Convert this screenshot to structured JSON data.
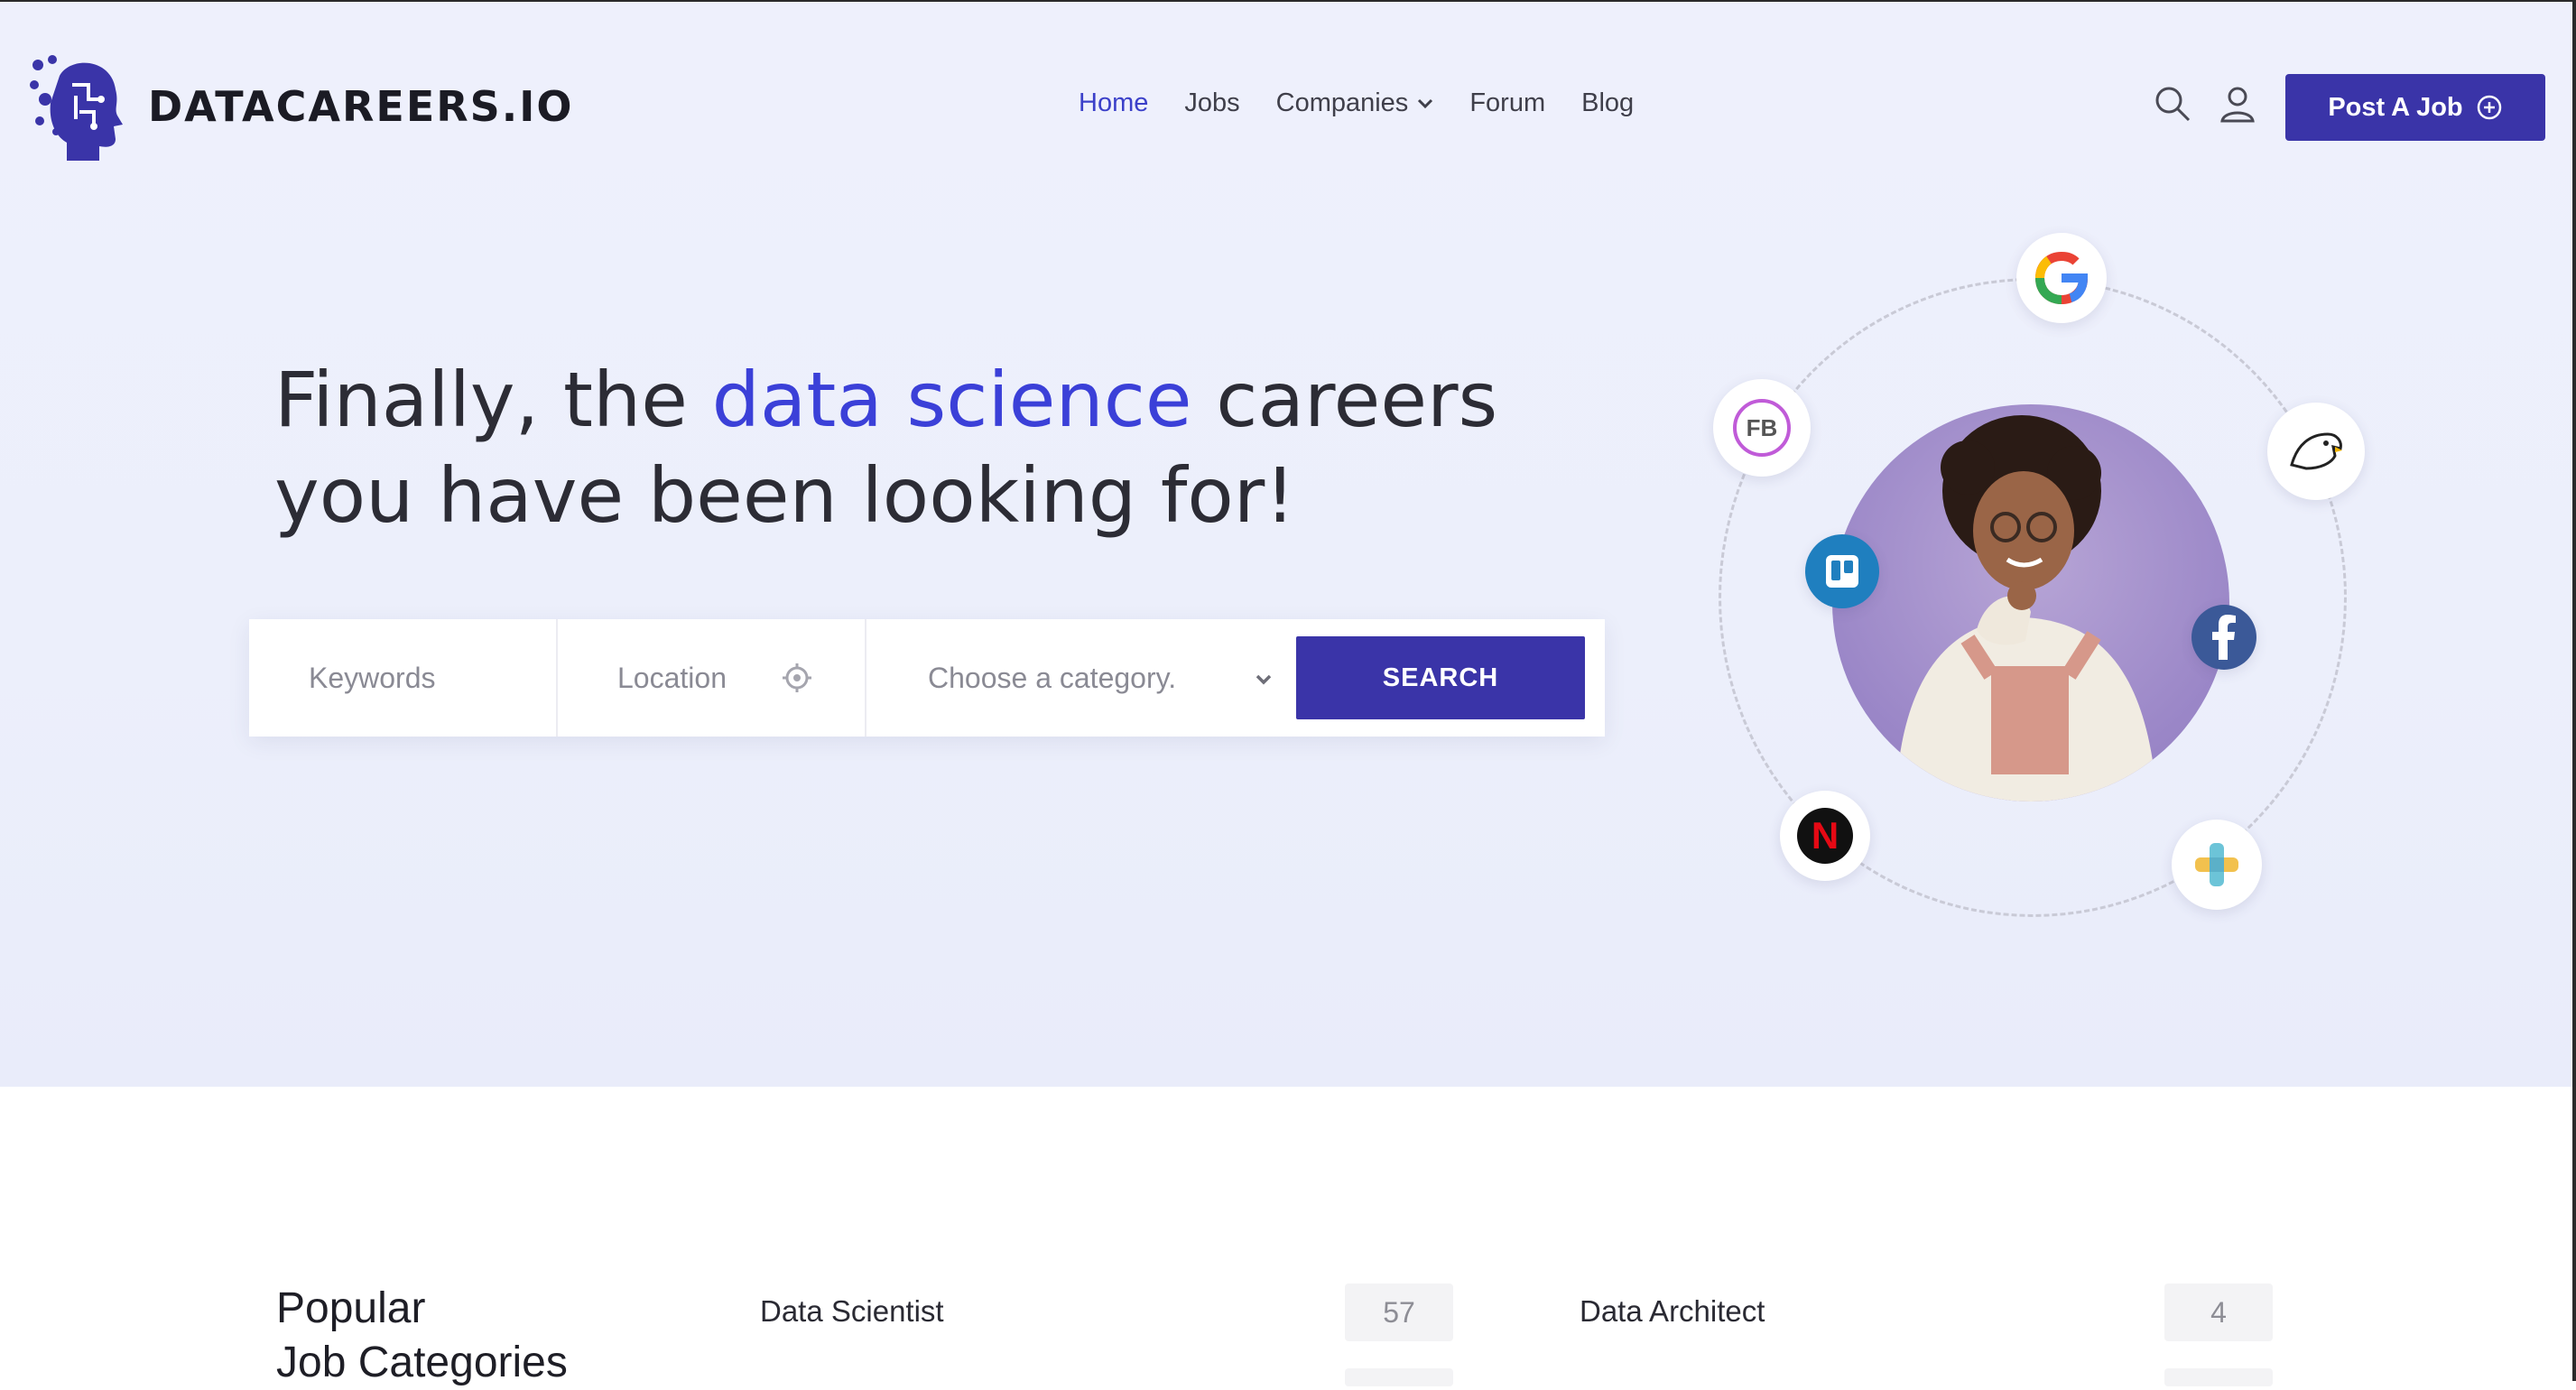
{
  "brand": {
    "name": "DATACAREERS.IO",
    "accent": "#3b40d8",
    "button": "#3a34a8"
  },
  "nav": {
    "items": [
      {
        "label": "Home",
        "active": true
      },
      {
        "label": "Jobs"
      },
      {
        "label": "Companies",
        "has_dropdown": true
      },
      {
        "label": "Forum"
      },
      {
        "label": "Blog"
      }
    ],
    "search_icon": "search-icon",
    "account_icon": "user-icon",
    "post_job_label": "Post A Job"
  },
  "hero": {
    "headline_part1": "Finally, the ",
    "headline_accent": "data science",
    "headline_part2": " careers",
    "headline_line2": "you have been looking for!"
  },
  "search": {
    "keywords_placeholder": "Keywords",
    "location_placeholder": "Location",
    "category_placeholder": "Choose a category.",
    "button_label": "SEARCH"
  },
  "logos": {
    "google": "G",
    "fb_ring": "FB",
    "netflix": "N"
  },
  "categories": {
    "title_line1": "Popular",
    "title_line2": "Job Categories",
    "items": [
      {
        "name": "Data Scientist",
        "count": "57"
      },
      {
        "name": "Data Architect",
        "count": "4"
      }
    ]
  }
}
